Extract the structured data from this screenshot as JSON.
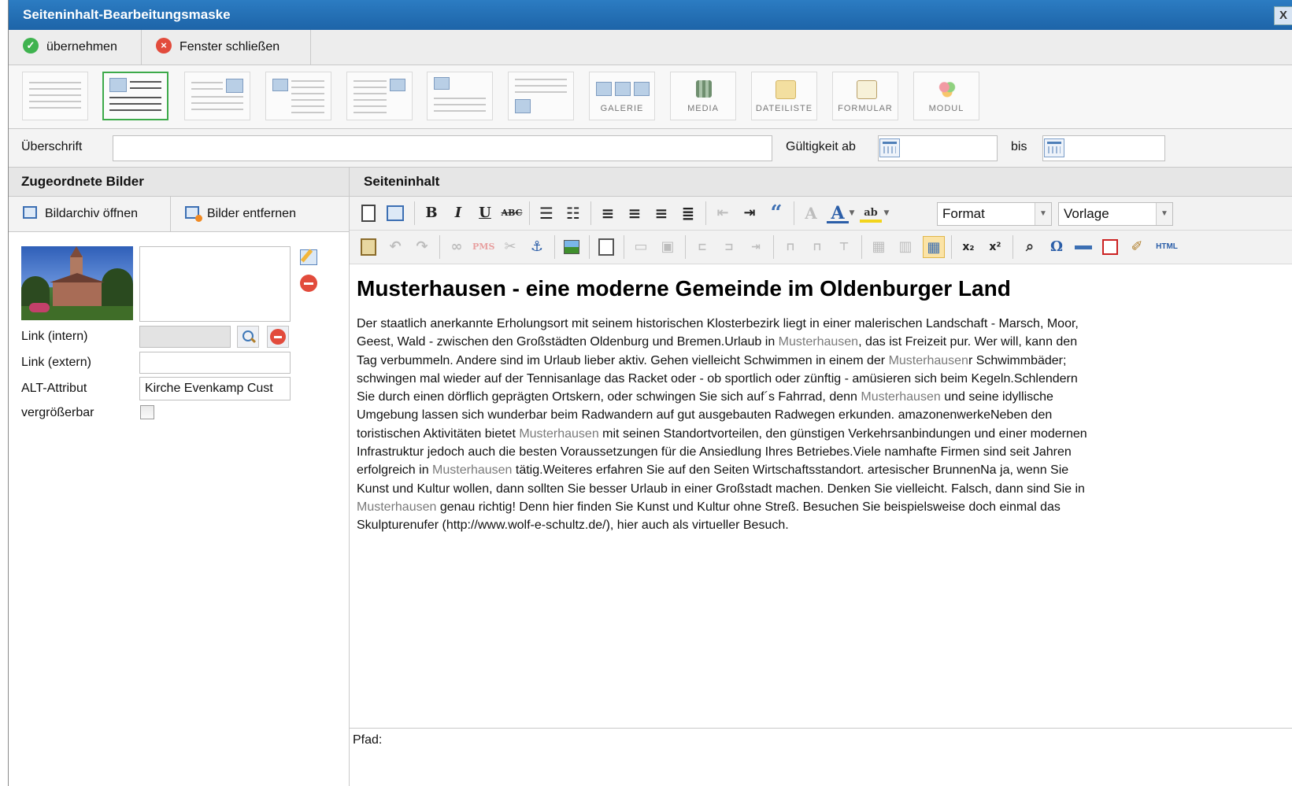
{
  "window": {
    "title": "Seiteninhalt-Bearbeitungsmaske",
    "close_glyph": "X"
  },
  "actions": {
    "apply_label": "übernehmen",
    "close_label": "Fenster schließen"
  },
  "layouts": {
    "gallery": "GALERIE",
    "media": "MEDIA",
    "filelist": "DATEILISTE",
    "form": "FORMULAR",
    "module": "MODUL"
  },
  "header": {
    "heading_label": "Überschrift",
    "heading_value": "",
    "valid_from_label": "Gültigkeit ab",
    "valid_from_value": "",
    "until_label": "bis",
    "until_value": ""
  },
  "images_panel": {
    "title": "Zugeordnete Bilder",
    "open_archive": "Bildarchiv öffnen",
    "remove_images": "Bilder entfernen",
    "caption_value": "",
    "link_intern_label": "Link (intern)",
    "link_extern_label": "Link (extern)",
    "alt_label": "ALT-Attribut",
    "alt_value": "Kirche Evenkamp Cust",
    "zoom_label": "vergrößerbar",
    "zoom_checked": false
  },
  "content_panel": {
    "title": "Seiteninhalt",
    "format_select": "Format",
    "template_select": "Vorlage",
    "path_label": "Pfad:",
    "heading": "Musterhausen - eine moderne Gemeinde im Oldenburger Land",
    "text_1": "Der staatlich anerkannte Erholungsort mit seinem historischen Klosterbezirk liegt in einer malerischen Landschaft - Marsch, Moor, Geest, Wald - zwischen den Großstädten Oldenburg und Bremen.Urlaub in ",
    "link_1": "Musterhausen",
    "text_2": ", das ist Freizeit pur. Wer will, kann den Tag verbummeln. Andere sind im Urlaub lieber aktiv. Gehen vielleicht Schwimmen in einem der ",
    "link_2": "Musterhausen",
    "text_3": "r Schwimmbäder; schwingen mal wieder auf der Tennisanlage das Racket oder - ob sportlich oder zünftig - amüsieren sich beim Kegeln.Schlendern Sie durch einen dörflich geprägten Ortskern, oder schwingen Sie sich auf´s Fahrrad, denn ",
    "link_3": "Musterhausen",
    "text_4": " und seine idyllische Umgebung lassen sich wunderbar beim Radwandern auf gut ausgebauten Radwegen erkunden. amazonenwerkeNeben den toristischen Aktivitäten bietet ",
    "link_4": "Musterhausen",
    "text_5": " mit seinen Standortvorteilen, den günstigen Verkehrsanbindungen und einer modernen Infrastruktur jedoch auch die besten Voraussetzungen für die Ansiedlung Ihres Betriebes.Viele namhafte Firmen sind seit Jahren erfolgreich in ",
    "link_5": "Musterhausen",
    "text_6": " tätig.Weiteres erfahren Sie auf den Seiten Wirtschaftsstandort. artesischer BrunnenNa ja, wenn Sie Kunst und Kultur wollen, dann sollten Sie besser Urlaub in einer Großstadt machen. Denken Sie vielleicht. Falsch, dann sind Sie in ",
    "link_6": "Musterhausen",
    "text_7": " genau richtig! Denn hier finden Sie Kunst und Kultur ohne Streß. Besuchen Sie beispielsweise doch einmal das Skulpturenufer (http://www.wolf-e-schultz.de/), hier auch als virtueller Besuch."
  },
  "toolbar_glyphs": {
    "bold": "B",
    "italic": "I",
    "underline": "U",
    "strike": "ABC",
    "blockquote": "“",
    "anchor": "⚓",
    "subscript": "x₂",
    "superscript": "x²",
    "find": "⌕",
    "omega": "Ω",
    "html": "HTML"
  },
  "colors": {
    "title_bar": "#1d64a8",
    "apply_green": "#3fb34f",
    "close_red": "#e24b3c",
    "selected_layout": "#3daa4a",
    "link_gray": "#7a7a7a"
  }
}
